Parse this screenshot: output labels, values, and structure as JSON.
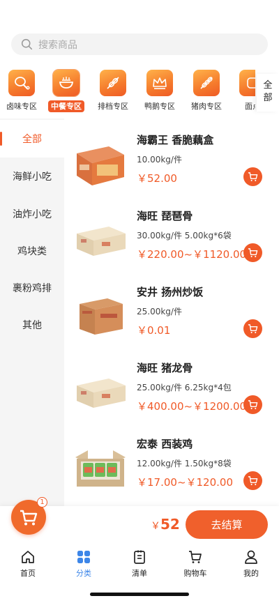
{
  "search": {
    "placeholder": "搜索商品",
    "icon": "search-icon"
  },
  "categories": [
    {
      "label": "卤味专区",
      "icon": "drumstick-icon",
      "active": false
    },
    {
      "label": "中餐专区",
      "icon": "bowl-icon",
      "active": true
    },
    {
      "label": "排档专区",
      "icon": "skewer-icon",
      "active": false
    },
    {
      "label": "鸭鹅专区",
      "icon": "crown-icon",
      "active": false
    },
    {
      "label": "猪肉专区",
      "icon": "skewer-icon",
      "active": false
    },
    {
      "label": "面点",
      "icon": "bread-icon",
      "active": false
    }
  ],
  "all_categories_label": "全部",
  "sidebar": [
    {
      "label": "全部",
      "active": true
    },
    {
      "label": "海鲜小吃",
      "active": false
    },
    {
      "label": "油炸小吃",
      "active": false
    },
    {
      "label": "鸡块类",
      "active": false
    },
    {
      "label": "裹粉鸡排",
      "active": false
    },
    {
      "label": "其他",
      "active": false
    }
  ],
  "products": [
    {
      "title": "海霸王 香脆藕盒",
      "spec": "10.00kg/件",
      "price": "￥52.00"
    },
    {
      "title": "海旺 琵琶骨",
      "spec": "30.00kg/件 5.00kg*6袋",
      "price": "￥220.00~￥1120.00"
    },
    {
      "title": "安井 扬州炒饭",
      "spec": "25.00kg/件",
      "price": "￥0.01"
    },
    {
      "title": "海旺 猪龙骨",
      "spec": "25.00kg/件 6.25kg*4包",
      "price": "￥400.00~￥1200.00"
    },
    {
      "title": "宏泰 西装鸡",
      "spec": "12.00kg/件 1.50kg*8袋",
      "price": "￥17.00~￥120.00"
    }
  ],
  "cart": {
    "badge": "1",
    "currency": "￥",
    "total": "52",
    "checkout_label": "去结算"
  },
  "tabs": [
    {
      "label": "首页",
      "icon": "home-icon",
      "active": false
    },
    {
      "label": "分类",
      "icon": "category-grid-icon",
      "active": true
    },
    {
      "label": "清单",
      "icon": "list-icon",
      "active": false
    },
    {
      "label": "购物车",
      "icon": "cart-icon",
      "active": false
    },
    {
      "label": "我的",
      "icon": "user-icon",
      "active": false
    }
  ],
  "colors": {
    "accent": "#f05a28",
    "tab_active": "#3d86e8",
    "sidebar_bg": "#f5f5f5"
  }
}
